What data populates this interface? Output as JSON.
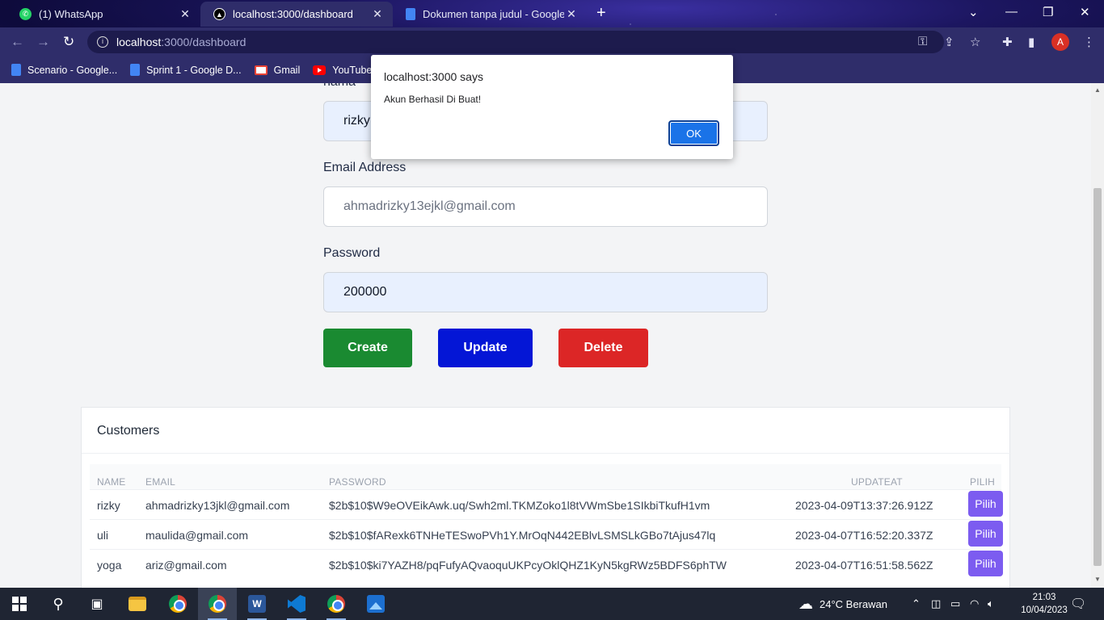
{
  "browser": {
    "tabs": [
      {
        "title": "(1) WhatsApp",
        "icon": "whatsapp-icon"
      },
      {
        "title": "localhost:3000/dashboard",
        "icon": "nextjs-icon"
      },
      {
        "title": "Dokumen tanpa judul - Google D",
        "icon": "google-docs-icon"
      }
    ],
    "url_host": "localhost",
    "url_path": ":3000/dashboard",
    "profile_initial": "A",
    "bookmarks": [
      {
        "label": "Scenario - Google...",
        "icon": "google-docs-icon"
      },
      {
        "label": "Sprint 1 - Google D...",
        "icon": "google-docs-icon"
      },
      {
        "label": "Gmail",
        "icon": "gmail-icon"
      },
      {
        "label": "YouTube",
        "icon": "youtube-icon"
      }
    ]
  },
  "form": {
    "name_label": "nama",
    "name_value": "rizky",
    "email_label": "Email Address",
    "email_placeholder": "ahmadrizky13ejkl@gmail.com",
    "password_label": "Password",
    "password_value": "200000",
    "create_label": "Create",
    "update_label": "Update",
    "delete_label": "Delete"
  },
  "customers": {
    "title": "Customers",
    "columns": [
      "NAME",
      "EMAIL",
      "PASSWORD",
      "UPDATEAT",
      "PILIH"
    ],
    "rows": [
      {
        "name": "rizky",
        "email": "ahmadrizky13jkl@gmail.com",
        "password": "$2b$10$W9eOVEikAwk.uq/Swh2ml.TKMZoko1l8tVWmSbe1SIkbiTkufH1vm",
        "updated": "2023-04-09T13:37:26.912Z",
        "action": "Pilih"
      },
      {
        "name": "uli",
        "email": "maulida@gmail.com",
        "password": "$2b$10$fARexk6TNHeTESwoPVh1Y.MrOqN442EBlvLSMSLkGBo7tAjus47lq",
        "updated": "2023-04-07T16:52:20.337Z",
        "action": "Pilih"
      },
      {
        "name": "yoga",
        "email": "ariz@gmail.com",
        "password": "$2b$10$ki7YAZH8/pqFufyAQvaoquUKPcyOklQHZ1KyN5kgRWz5BDFS6phTW",
        "updated": "2023-04-07T16:51:58.562Z",
        "action": "Pilih"
      }
    ]
  },
  "dialog": {
    "title": "localhost:3000 says",
    "message": "Akun Berhasil Di Buat!",
    "ok_label": "OK"
  },
  "taskbar": {
    "weather": "24°C  Berawan",
    "time": "21:03",
    "date": "10/04/2023"
  },
  "colors": {
    "create": "#1a8a31",
    "update": "#0416d6",
    "delete": "#dc2626",
    "pilih": "#7c5cf0",
    "dialog_ok": "#1a73e8"
  }
}
